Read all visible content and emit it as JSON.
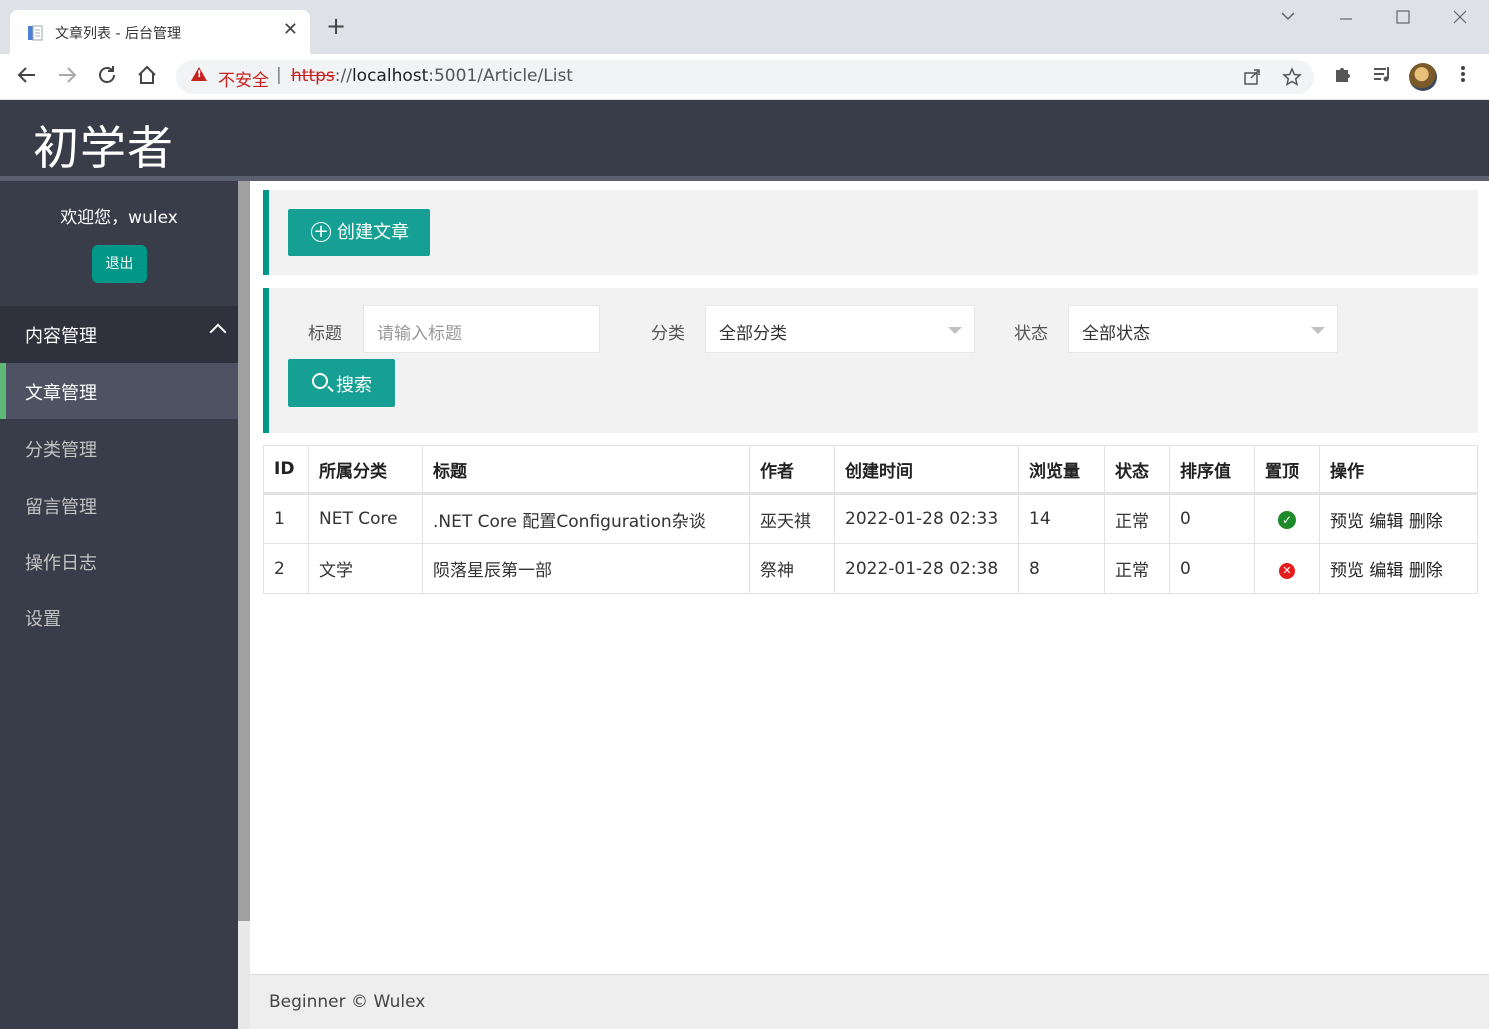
{
  "browser": {
    "tab_title": "文章列表 - 后台管理",
    "tab_close": "✕",
    "new_tab": "+",
    "insecure_label": "不安全",
    "separator": "|",
    "url_scheme": "https",
    "url_sep": "://",
    "url_host": "localhost",
    "url_rest": ":5001/Article/List"
  },
  "app": {
    "logo": "初学者",
    "welcome": "欢迎您，wulex",
    "logout": "退出"
  },
  "sidebar": {
    "group_label": "内容管理",
    "items": [
      {
        "label": "文章管理",
        "active": true
      },
      {
        "label": "分类管理",
        "active": false
      },
      {
        "label": "留言管理",
        "active": false
      },
      {
        "label": "操作日志",
        "active": false
      },
      {
        "label": "设置",
        "active": false
      }
    ]
  },
  "actions": {
    "create_article": "创建文章",
    "plus_glyph": "+"
  },
  "filters": {
    "title_label": "标题",
    "title_placeholder": "请输入标题",
    "category_label": "分类",
    "category_value": "全部分类",
    "status_label": "状态",
    "status_value": "全部状态",
    "search": "搜索"
  },
  "table": {
    "headers": [
      "ID",
      "所属分类",
      "标题",
      "作者",
      "创建时间",
      "浏览量",
      "状态",
      "排序值",
      "置顶",
      "操作"
    ],
    "rows": [
      {
        "id": "1",
        "category": "NET Core",
        "title": ".NET Core 配置Configuration杂谈",
        "author": "巫天祺",
        "created": "2022-01-28 02:33",
        "views": "14",
        "status": "正常",
        "sort": "0",
        "top": true,
        "top_glyph": "✓"
      },
      {
        "id": "2",
        "category": "文学",
        "title": "陨落星辰第一部",
        "author": "祭神",
        "created": "2022-01-28 02:38",
        "views": "8",
        "status": "正常",
        "sort": "0",
        "top": false,
        "top_glyph": "✕"
      }
    ],
    "ops": {
      "preview": "预览",
      "edit": "编辑",
      "delete": "删除"
    }
  },
  "footer": {
    "text": "Beginner © Wulex"
  },
  "colors": {
    "primary": "#009688",
    "button": "#16a094",
    "sidebar_bg": "#393d49",
    "active_bar": "#5fb878",
    "insecure_red": "#c5221f"
  }
}
